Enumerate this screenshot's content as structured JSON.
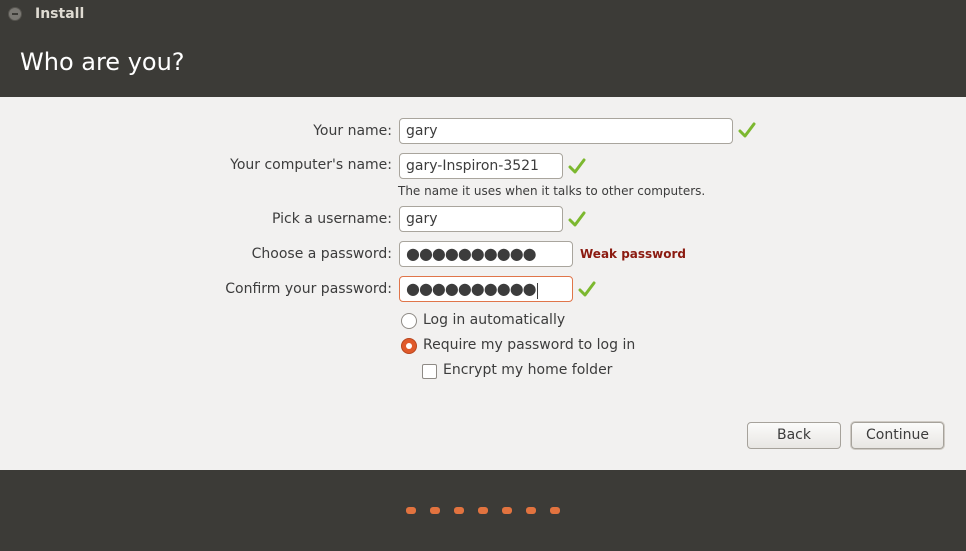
{
  "window": {
    "title": "Install"
  },
  "header": {
    "title": "Who are you?"
  },
  "form": {
    "name_label": "Your name:",
    "name_value": "gary",
    "computer_label": "Your computer's name:",
    "computer_value": "gary-Inspiron-3521",
    "computer_hint": "The name it uses when it talks to other computers.",
    "username_label": "Pick a username:",
    "username_value": "gary",
    "password_label": "Choose a password:",
    "password_dots": "●●●●●●●●●●",
    "password_strength": "Weak password",
    "confirm_label": "Confirm your password:",
    "confirm_dots": "●●●●●●●●●●"
  },
  "options": {
    "login_auto": "Log in automatically",
    "require_password": "Require my password to log in",
    "encrypt_home": "Encrypt my home folder",
    "selected": "require_password",
    "encrypt_checked": false
  },
  "buttons": {
    "back": "Back",
    "continue": "Continue"
  },
  "progress": {
    "total_steps": 7
  },
  "colors": {
    "accent": "#e05a2b",
    "dark_bg": "#3c3b37",
    "check": "#7cb82f",
    "weak": "#8b1a10"
  }
}
